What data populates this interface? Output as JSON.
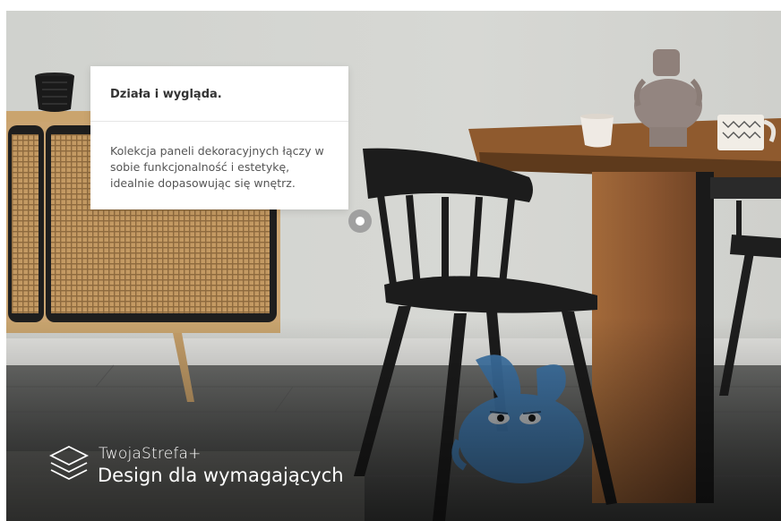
{
  "card": {
    "title": "Działa i wygląda.",
    "body": "Kolekcja paneli dekoracyjnych łączy w sobie funkcjonalność i estetykę, idealnie dopasowując się wnętrz."
  },
  "brand": {
    "name": "TwojaStrefa+",
    "tagline": "Design dla wymagających",
    "icon": "layers-stack-icon"
  },
  "hotspot": {
    "icon": "hotspot-dot-icon"
  },
  "colors": {
    "wall": "#cfd1cd",
    "floor": "#5a5c5b",
    "table_wood": "#8a5a32",
    "chair": "#1c1c1c",
    "mascot": "#3f78ad",
    "card_bg": "#ffffff"
  }
}
